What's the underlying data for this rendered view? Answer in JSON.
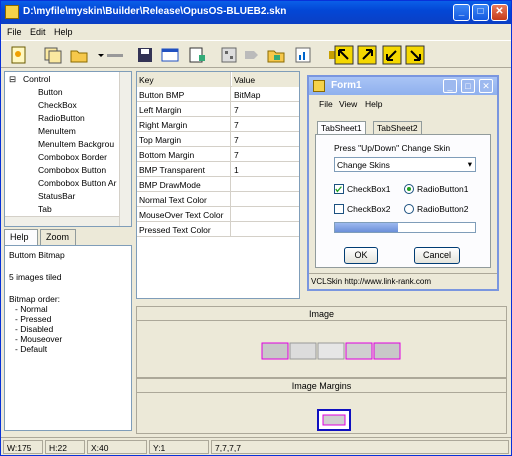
{
  "window": {
    "title": "D:\\myfile\\myskin\\Builder\\Release\\OpusOS-BLUEB2.skn"
  },
  "menu": {
    "file": "File",
    "edit": "Edit",
    "help": "Help"
  },
  "tree": {
    "root": "Control",
    "items": [
      "Button",
      "CheckBox",
      "RadioButton",
      "MenuItem",
      "MenuItem Backgrou",
      "Combobox Border",
      "Combobox Button",
      "Combobox Button Ar",
      "StatusBar",
      "Tab"
    ]
  },
  "help_tabs": {
    "help": "Help",
    "zoom": "Zoom"
  },
  "help_text": {
    "line1": "Buttom Bitmap",
    "line2": "5 images tiled",
    "line3": "Bitmap order:",
    "line4": "- Normal",
    "line5": "- Pressed",
    "line6": "- Disabled",
    "line7": "- Mouseover",
    "line8": "- Default"
  },
  "grid": {
    "key_header": "Key",
    "value_header": "Value",
    "rows": [
      {
        "k": "Button BMP",
        "v": "BitMap"
      },
      {
        "k": "Left Margin",
        "v": "7"
      },
      {
        "k": "Right Margin",
        "v": "7"
      },
      {
        "k": "Top Margin",
        "v": "7"
      },
      {
        "k": "Bottom Margin",
        "v": "7"
      },
      {
        "k": "BMP Transparent",
        "v": "1"
      },
      {
        "k": "BMP DrawMode",
        "v": ""
      },
      {
        "k": "Normal Text Color",
        "v": ""
      },
      {
        "k": "MouseOver Text Color",
        "v": ""
      },
      {
        "k": "Pressed Text Color",
        "v": ""
      }
    ]
  },
  "form1": {
    "title": "Form1",
    "menu": {
      "file": "File",
      "view": "View",
      "help": "Help"
    },
    "tab1": "TabSheet1",
    "tab2": "TabSheet2",
    "prompt": "Press \"Up/Down\" Change Skin",
    "combo_value": "Change Skins",
    "checkbox1": "CheckBox1",
    "checkbox2": "CheckBox2",
    "radio1": "RadioButton1",
    "radio2": "RadioButton2",
    "progress": 0.45,
    "ok": "OK",
    "cancel": "Cancel",
    "status": "VCLSkin http://www.link-rank.com"
  },
  "panes": {
    "image": "Image",
    "margins": "Image Margins"
  },
  "status": {
    "w": "W:175",
    "h": "H:22",
    "x": "X:40",
    "y": "Y:1",
    "margins": "7,7,7,7"
  },
  "colors": {
    "accent": "#0a5fe8",
    "toolbar_arrow": "#f5d800",
    "selection_magenta": "#e000e0"
  }
}
